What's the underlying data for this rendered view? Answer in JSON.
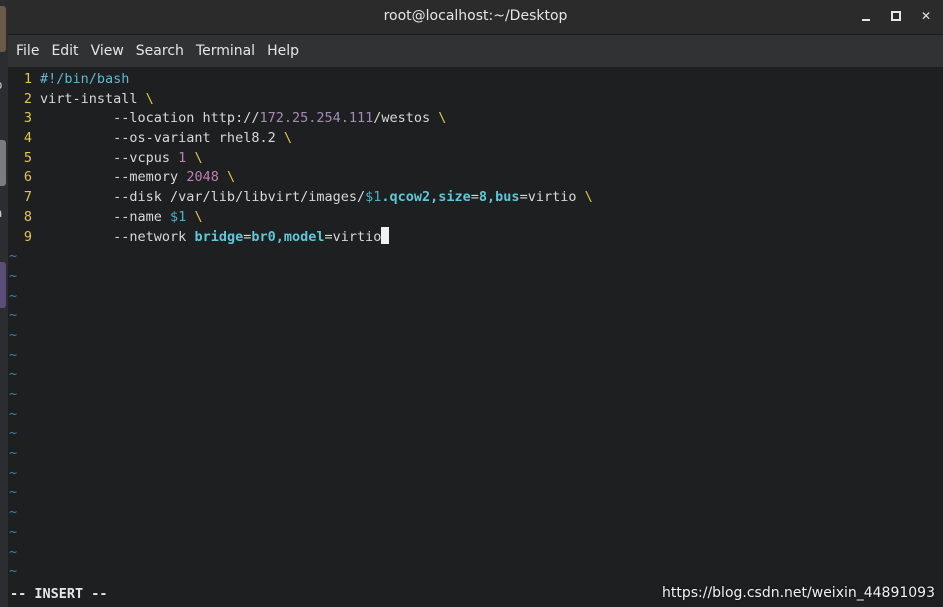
{
  "window": {
    "title": "root@localhost:~/Desktop"
  },
  "menubar": {
    "items": [
      "File",
      "Edit",
      "View",
      "Search",
      "Terminal",
      "Help"
    ]
  },
  "editor": {
    "lines": [
      {
        "num": "1",
        "segments": [
          {
            "t": "#!/bin/bash",
            "c": "c-comment"
          }
        ]
      },
      {
        "num": "2",
        "segments": [
          {
            "t": "virt-install ",
            "c": "c-op"
          },
          {
            "t": "\\",
            "c": "c-cont"
          }
        ]
      },
      {
        "num": "3",
        "segments": [
          {
            "t": "         --location http://",
            "c": "c-op"
          },
          {
            "t": "172.25.254.111",
            "c": "c-dim"
          },
          {
            "t": "/westos ",
            "c": "c-op"
          },
          {
            "t": "\\",
            "c": "c-cont"
          }
        ]
      },
      {
        "num": "4",
        "segments": [
          {
            "t": "         --os-variant rhel8.2 ",
            "c": "c-op"
          },
          {
            "t": "\\",
            "c": "c-cont"
          }
        ]
      },
      {
        "num": "5",
        "segments": [
          {
            "t": "         --vcpus ",
            "c": "c-op"
          },
          {
            "t": "1",
            "c": "c-num"
          },
          {
            "t": " ",
            "c": "c-op"
          },
          {
            "t": "\\",
            "c": "c-cont"
          }
        ]
      },
      {
        "num": "6",
        "segments": [
          {
            "t": "         --memory ",
            "c": "c-op"
          },
          {
            "t": "2048",
            "c": "c-num"
          },
          {
            "t": " ",
            "c": "c-op"
          },
          {
            "t": "\\",
            "c": "c-cont"
          }
        ]
      },
      {
        "num": "7",
        "segments": [
          {
            "t": "         --disk /var/lib/libvirt/images/",
            "c": "c-op"
          },
          {
            "t": "$1",
            "c": "c-var"
          },
          {
            "t": ".qcow2,size",
            "c": "c-key"
          },
          {
            "t": "=",
            "c": "c-op"
          },
          {
            "t": "8,bus",
            "c": "c-key"
          },
          {
            "t": "=virtio ",
            "c": "c-op"
          },
          {
            "t": "\\",
            "c": "c-cont"
          }
        ]
      },
      {
        "num": "8",
        "segments": [
          {
            "t": "         --name ",
            "c": "c-op"
          },
          {
            "t": "$1",
            "c": "c-var"
          },
          {
            "t": " ",
            "c": "c-op"
          },
          {
            "t": "\\",
            "c": "c-cont"
          }
        ]
      },
      {
        "num": "9",
        "segments": [
          {
            "t": "         --network ",
            "c": "c-op"
          },
          {
            "t": "bridge",
            "c": "c-key"
          },
          {
            "t": "=",
            "c": "c-op"
          },
          {
            "t": "br0,model",
            "c": "c-key"
          },
          {
            "t": "=virtio",
            "c": "c-op"
          }
        ],
        "cursor": true
      }
    ],
    "empty_line_marker": "~",
    "empty_line_count": 17
  },
  "statusbar": {
    "mode": "-- INSERT --",
    "watermark": "https://blog.csdn.net/weixin_44891093"
  },
  "desktop": {
    "labels": [
      "o",
      "a",
      "t"
    ]
  },
  "colors": {
    "line_number": "#e3c54d",
    "tilde": "#3d7fa8",
    "background": "#1d1f21"
  }
}
